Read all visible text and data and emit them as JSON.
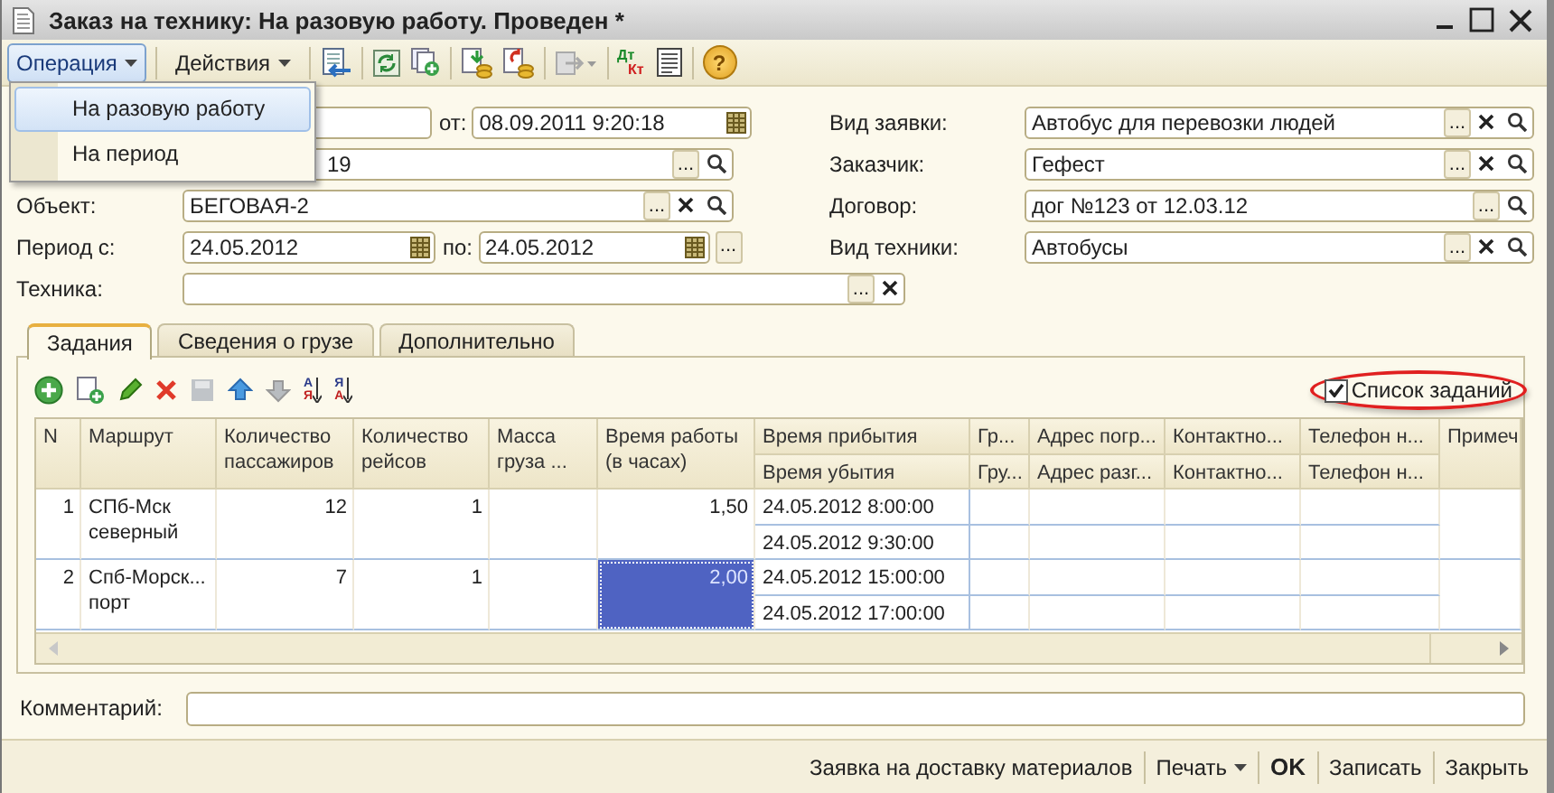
{
  "window": {
    "title": "Заказ на технику: На разовую работу. Проведен *"
  },
  "toolbar": {
    "menus": [
      {
        "label": "Операция",
        "open": true
      },
      {
        "label": "Действия",
        "open": false
      }
    ],
    "icons": [
      {
        "kind": "doc_arrow"
      },
      {
        "kind": "refresh"
      },
      {
        "kind": "copy_add"
      },
      {
        "kind": "coins_in"
      },
      {
        "kind": "coins_out"
      },
      {
        "kind": "disabled_dropdown"
      },
      {
        "kind": "dt_kt",
        "top": "Дт",
        "bottom": "Кт"
      },
      {
        "kind": "report"
      },
      {
        "kind": "help",
        "glyph": "?"
      }
    ]
  },
  "operation_menu": {
    "items": [
      {
        "label": "На разовую работу",
        "selected": true
      },
      {
        "label": "На период",
        "selected": false
      }
    ]
  },
  "left_rows": [
    {
      "items": [
        {
          "kind": "field"
        },
        {
          "kind": "label",
          "text": "от:"
        },
        {
          "kind": "field",
          "value": "08.09.2011  9:20:18",
          "buttons": [
            {
              "kind": "calendar"
            }
          ]
        }
      ]
    },
    {
      "items": [
        {
          "kind": "field",
          "value": "19",
          "buttons": [
            {
              "kind": "select",
              "label": "..."
            },
            {
              "kind": "search"
            }
          ]
        }
      ]
    },
    {
      "label": "Объект:",
      "items": [
        {
          "kind": "field",
          "value": "БЕГОВАЯ-2",
          "buttons": [
            {
              "kind": "select",
              "label": "..."
            },
            {
              "kind": "clear"
            },
            {
              "kind": "search"
            }
          ]
        }
      ]
    },
    {
      "label": "Период с:",
      "items": [
        {
          "kind": "field",
          "value": "24.05.2012",
          "buttons": [
            {
              "kind": "calendar"
            }
          ]
        },
        {
          "kind": "label",
          "text": "по:"
        },
        {
          "kind": "field",
          "value": "24.05.2012",
          "buttons": [
            {
              "kind": "calendar"
            }
          ]
        },
        {
          "kind": "button",
          "label": "..."
        }
      ]
    },
    {
      "label": "Техника:",
      "items": [
        {
          "kind": "field",
          "buttons": [
            {
              "kind": "select",
              "label": "..."
            },
            {
              "kind": "clear"
            }
          ]
        }
      ]
    }
  ],
  "right_rows": [
    {
      "label": "Вид заявки:",
      "value": "Автобус для перевозки людей",
      "buttons": [
        {
          "kind": "select",
          "label": "..."
        },
        {
          "kind": "clear"
        },
        {
          "kind": "search"
        }
      ]
    },
    {
      "label": "Заказчик:",
      "value": "Гефест",
      "buttons": [
        {
          "kind": "select",
          "label": "..."
        },
        {
          "kind": "clear"
        },
        {
          "kind": "search"
        }
      ]
    },
    {
      "label": "Договор:",
      "value": "дог №123 от 12.03.12",
      "buttons": [
        {
          "kind": "select",
          "label": "..."
        },
        {
          "kind": "search"
        }
      ]
    },
    {
      "label": "Вид техники:",
      "value": "Автобусы",
      "buttons": [
        {
          "kind": "select",
          "label": "..."
        },
        {
          "kind": "clear"
        },
        {
          "kind": "search"
        }
      ]
    }
  ],
  "tabs": [
    {
      "label": "Задания",
      "selected": true
    },
    {
      "label": "Сведения о грузе",
      "selected": false
    },
    {
      "label": "Дополнительно",
      "selected": false
    }
  ],
  "table_toolbar": [
    {
      "kind": "add"
    },
    {
      "kind": "copy_add"
    },
    {
      "kind": "edit"
    },
    {
      "kind": "delete"
    },
    {
      "kind": "save"
    },
    {
      "kind": "up"
    },
    {
      "kind": "down"
    },
    {
      "kind": "sort",
      "top": "А",
      "bottom": "Я"
    },
    {
      "kind": "sort",
      "top": "Я",
      "bottom": "А"
    }
  ],
  "task_list_checkbox": {
    "label": "Список заданий",
    "checked": true,
    "circled": true
  },
  "table": {
    "columns": [
      {
        "label": "N"
      },
      {
        "label": "Маршрут"
      },
      {
        "label": "Количество пассажиров"
      },
      {
        "label": "Количество рейсов"
      },
      {
        "label": "Масса груза ..."
      },
      {
        "label": "Время работы (в часах)"
      },
      {
        "label": "Время прибытия",
        "sub_label": "Время убытия"
      },
      {
        "label": "Гр...",
        "sub_label": "Гру..."
      },
      {
        "label": "Адрес погр...",
        "sub_label": "Адрес разг..."
      },
      {
        "label": "Контактно...",
        "sub_label": "Контактно..."
      },
      {
        "label": "Телефон н...",
        "sub_label": "Телефон н..."
      },
      {
        "label": "Примеч"
      }
    ],
    "rows": [
      {
        "n": "1",
        "route": "СПб-Мск северный",
        "passengers": "12",
        "trips": "1",
        "work_hours": "1,50",
        "arrival": "24.05.2012 8:00:00",
        "departure": "24.05.2012 9:30:00",
        "selected": false
      },
      {
        "n": "2",
        "route": "Спб-Морск... порт",
        "passengers": "7",
        "trips": "1",
        "work_hours": "2,00",
        "arrival": "24.05.2012 15:00:00",
        "departure": "24.05.2012 17:00:00",
        "selected": true
      }
    ]
  },
  "comment": {
    "label": "Комментарий:"
  },
  "footer_buttons": [
    {
      "label": "Заявка на доставку материалов",
      "kind": "plain"
    },
    {
      "label": "Печать",
      "kind": "dropdown"
    },
    {
      "label": "OK",
      "kind": "default"
    },
    {
      "label": "Записать",
      "kind": "plain"
    },
    {
      "label": "Закрыть",
      "kind": "plain"
    }
  ]
}
